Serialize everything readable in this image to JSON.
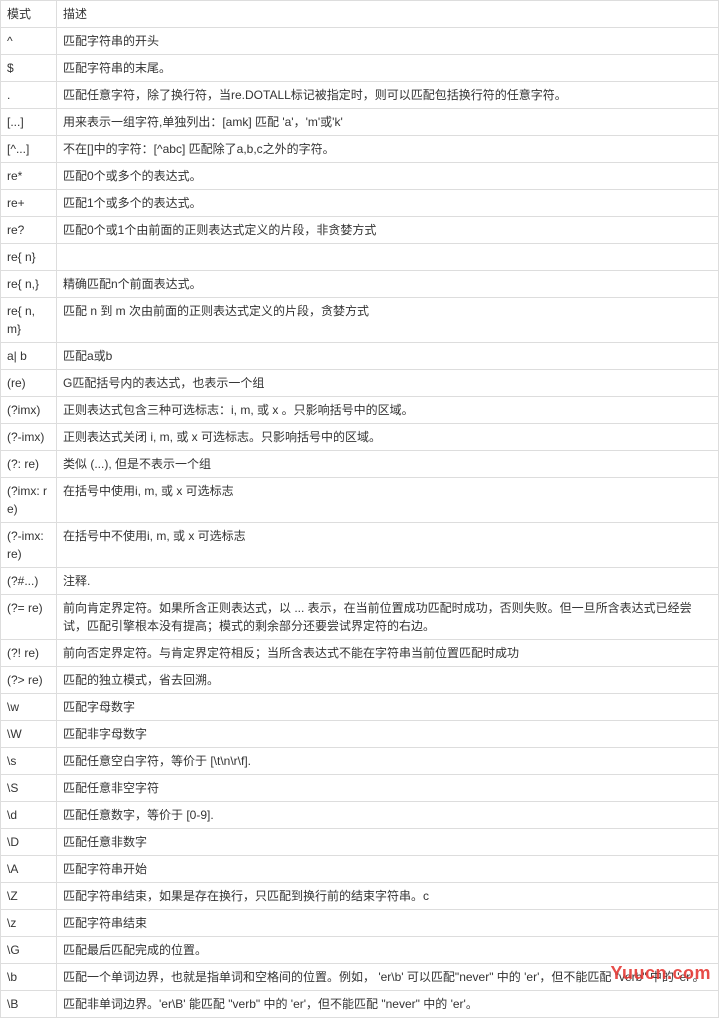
{
  "header": {
    "pattern": "模式",
    "description": "描述"
  },
  "rows": [
    {
      "pattern": "^",
      "description": "匹配字符串的开头"
    },
    {
      "pattern": "$",
      "description": "匹配字符串的末尾。"
    },
    {
      "pattern": ".",
      "description": "匹配任意字符，除了换行符，当re.DOTALL标记被指定时，则可以匹配包括换行符的任意字符。"
    },
    {
      "pattern": "[...]",
      "description": "用来表示一组字符,单独列出：[amk] 匹配 'a'，'m'或'k'"
    },
    {
      "pattern": "[^...]",
      "description": "不在[]中的字符：[^abc] 匹配除了a,b,c之外的字符。"
    },
    {
      "pattern": "re*",
      "description": "匹配0个或多个的表达式。"
    },
    {
      "pattern": "re+",
      "description": "匹配1个或多个的表达式。"
    },
    {
      "pattern": "re?",
      "description": "匹配0个或1个由前面的正则表达式定义的片段，非贪婪方式"
    },
    {
      "pattern": "re{ n}",
      "description": ""
    },
    {
      "pattern": "re{ n,}",
      "description": "精确匹配n个前面表达式。"
    },
    {
      "pattern": "re{ n, m}",
      "description": "匹配 n 到 m 次由前面的正则表达式定义的片段，贪婪方式"
    },
    {
      "pattern": "a| b",
      "description": "匹配a或b"
    },
    {
      "pattern": "(re)",
      "description": "G匹配括号内的表达式，也表示一个组"
    },
    {
      "pattern": "(?imx)",
      "description": "正则表达式包含三种可选标志：i, m, 或 x 。只影响括号中的区域。"
    },
    {
      "pattern": "(?-imx)",
      "description": "正则表达式关闭 i, m, 或 x 可选标志。只影响括号中的区域。"
    },
    {
      "pattern": "(?: re)",
      "description": "类似 (...), 但是不表示一个组"
    },
    {
      "pattern": "(?imx: re)",
      "description": "在括号中使用i, m, 或 x 可选标志"
    },
    {
      "pattern": "(?-imx: re)",
      "description": "在括号中不使用i, m, 或 x 可选标志"
    },
    {
      "pattern": "(?#...)",
      "description": "注释."
    },
    {
      "pattern": "(?= re)",
      "description": "前向肯定界定符。如果所含正则表达式，以 ... 表示，在当前位置成功匹配时成功，否则失败。但一旦所含表达式已经尝试，匹配引擎根本没有提高；模式的剩余部分还要尝试界定符的右边。"
    },
    {
      "pattern": "(?! re)",
      "description": "前向否定界定符。与肯定界定符相反；当所含表达式不能在字符串当前位置匹配时成功"
    },
    {
      "pattern": "(?> re)",
      "description": "匹配的独立模式，省去回溯。"
    },
    {
      "pattern": "\\w",
      "description": "匹配字母数字"
    },
    {
      "pattern": "\\W",
      "description": "匹配非字母数字"
    },
    {
      "pattern": "\\s",
      "description": "匹配任意空白字符，等价于 [\\t\\n\\r\\f]."
    },
    {
      "pattern": "\\S",
      "description": "匹配任意非空字符"
    },
    {
      "pattern": "\\d",
      "description": "匹配任意数字，等价于 [0-9]."
    },
    {
      "pattern": "\\D",
      "description": "匹配任意非数字"
    },
    {
      "pattern": "\\A",
      "description": "匹配字符串开始"
    },
    {
      "pattern": "\\Z",
      "description": "匹配字符串结束，如果是存在换行，只匹配到换行前的结束字符串。c"
    },
    {
      "pattern": "\\z",
      "description": "匹配字符串结束"
    },
    {
      "pattern": "\\G",
      "description": "匹配最后匹配完成的位置。"
    },
    {
      "pattern": "\\b",
      "description": "匹配一个单词边界，也就是指单词和空格间的位置。例如， 'er\\b' 可以匹配\"never\" 中的 'er'，但不能匹配 \"verb\" 中的 'er'。"
    },
    {
      "pattern": "\\B",
      "description": "匹配非单词边界。'er\\B' 能匹配 \"verb\" 中的 'er'，但不能匹配 \"never\" 中的 'er'。"
    }
  ],
  "watermark": "Yuucn.com"
}
